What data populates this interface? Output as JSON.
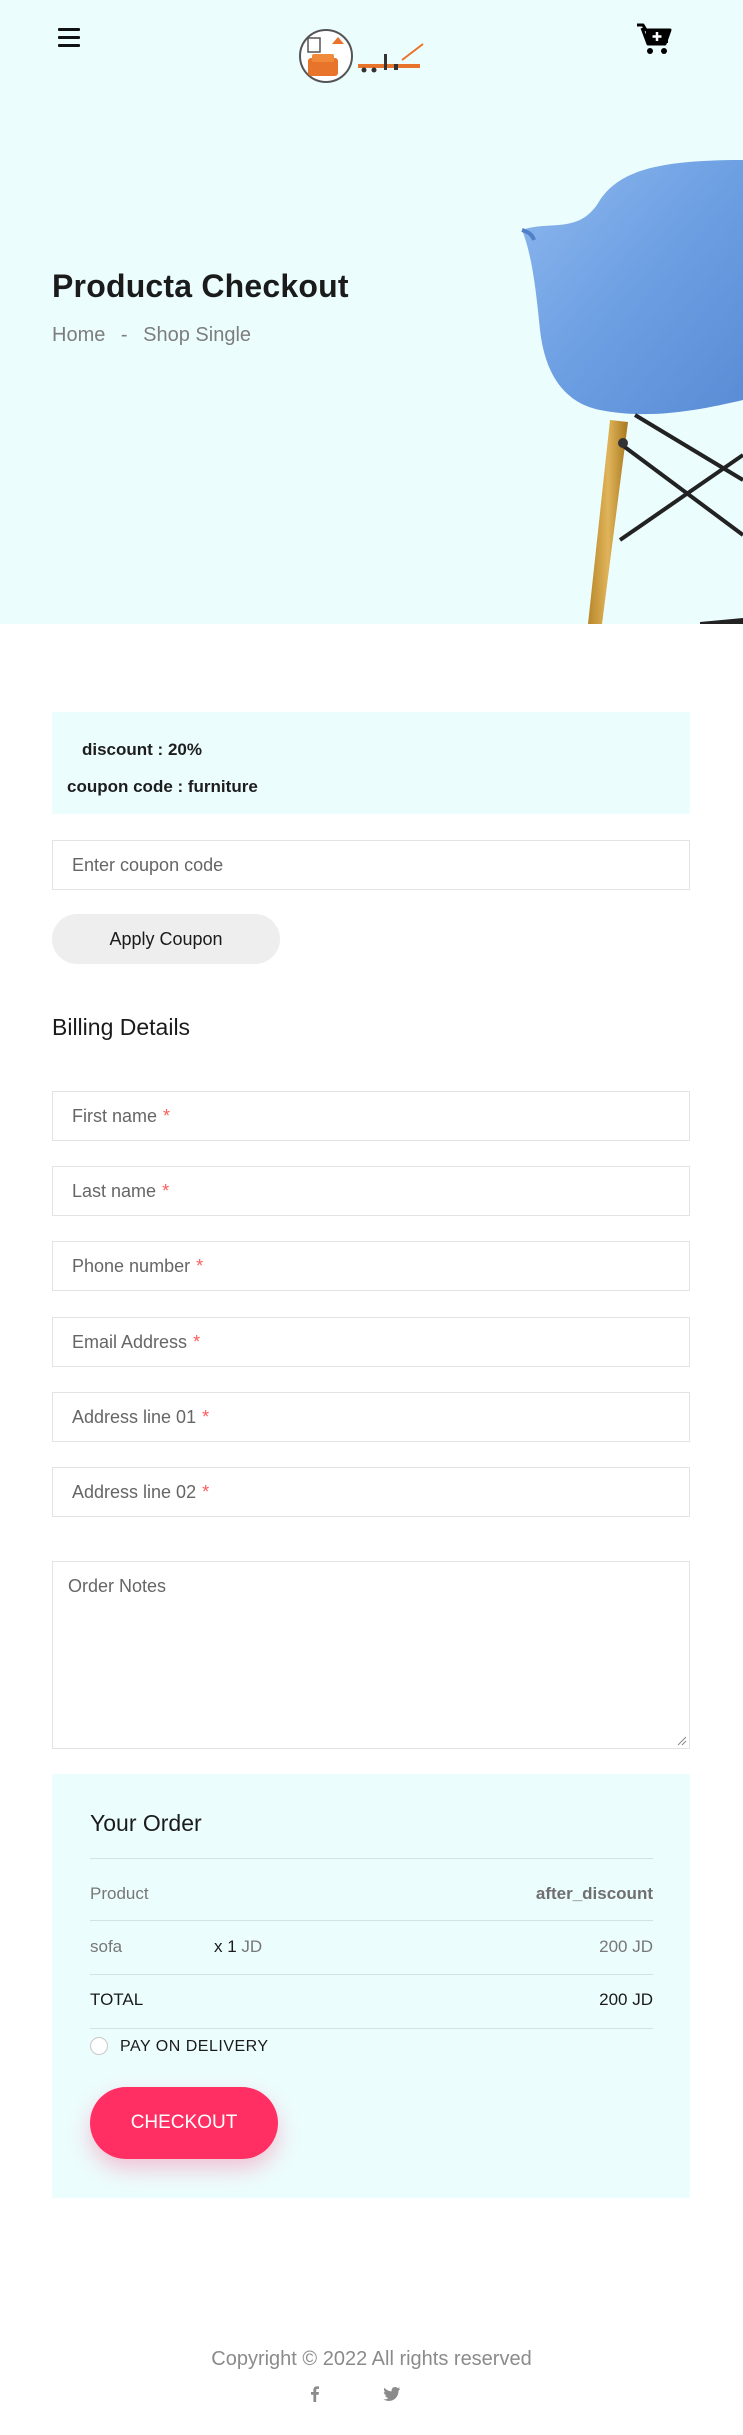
{
  "header": {
    "menu_icon": "hamburger-menu-icon",
    "logo_icon": "furniture-logo-icon",
    "cart_icon": "cart-plus-icon"
  },
  "hero": {
    "title": "Producta Checkout",
    "breadcrumb": [
      "Home",
      "-",
      "Shop Single"
    ],
    "background": "#ecfdfe"
  },
  "coupon": {
    "discount": "discount : 20%",
    "code": "coupon code : furniture",
    "placeholder": "Enter coupon code",
    "apply_label": "Apply Coupon"
  },
  "billing": {
    "title": "Billing Details",
    "fields": [
      {
        "label": "First name",
        "required": "*"
      },
      {
        "label": "Last name",
        "required": "*"
      },
      {
        "label": "Phone number",
        "required": "*"
      },
      {
        "label": "Email Address",
        "required": "*"
      },
      {
        "label": "Address line 01",
        "required": "*"
      },
      {
        "label": "Address line 02",
        "required": "*"
      }
    ],
    "notes_placeholder": "Order Notes"
  },
  "order": {
    "title": "Your Order",
    "header": {
      "left": "Product",
      "right": "after_discount"
    },
    "items": [
      {
        "name": "sofa",
        "qty": "x 1",
        "unit": "JD",
        "price": "200 JD"
      }
    ],
    "total_label": "TOTAL",
    "total_value": "200 JD",
    "payment_option": "PAY ON DELIVERY",
    "checkout_label": "CHECKOUT"
  },
  "footer": {
    "copyright": "Copyright © 2022 All rights reserved",
    "social": [
      "facebook-icon",
      "twitter-icon"
    ]
  },
  "colors": {
    "accent": "#ff2e63",
    "panel": "#ecfdfe",
    "required": "#ff5b5b"
  }
}
